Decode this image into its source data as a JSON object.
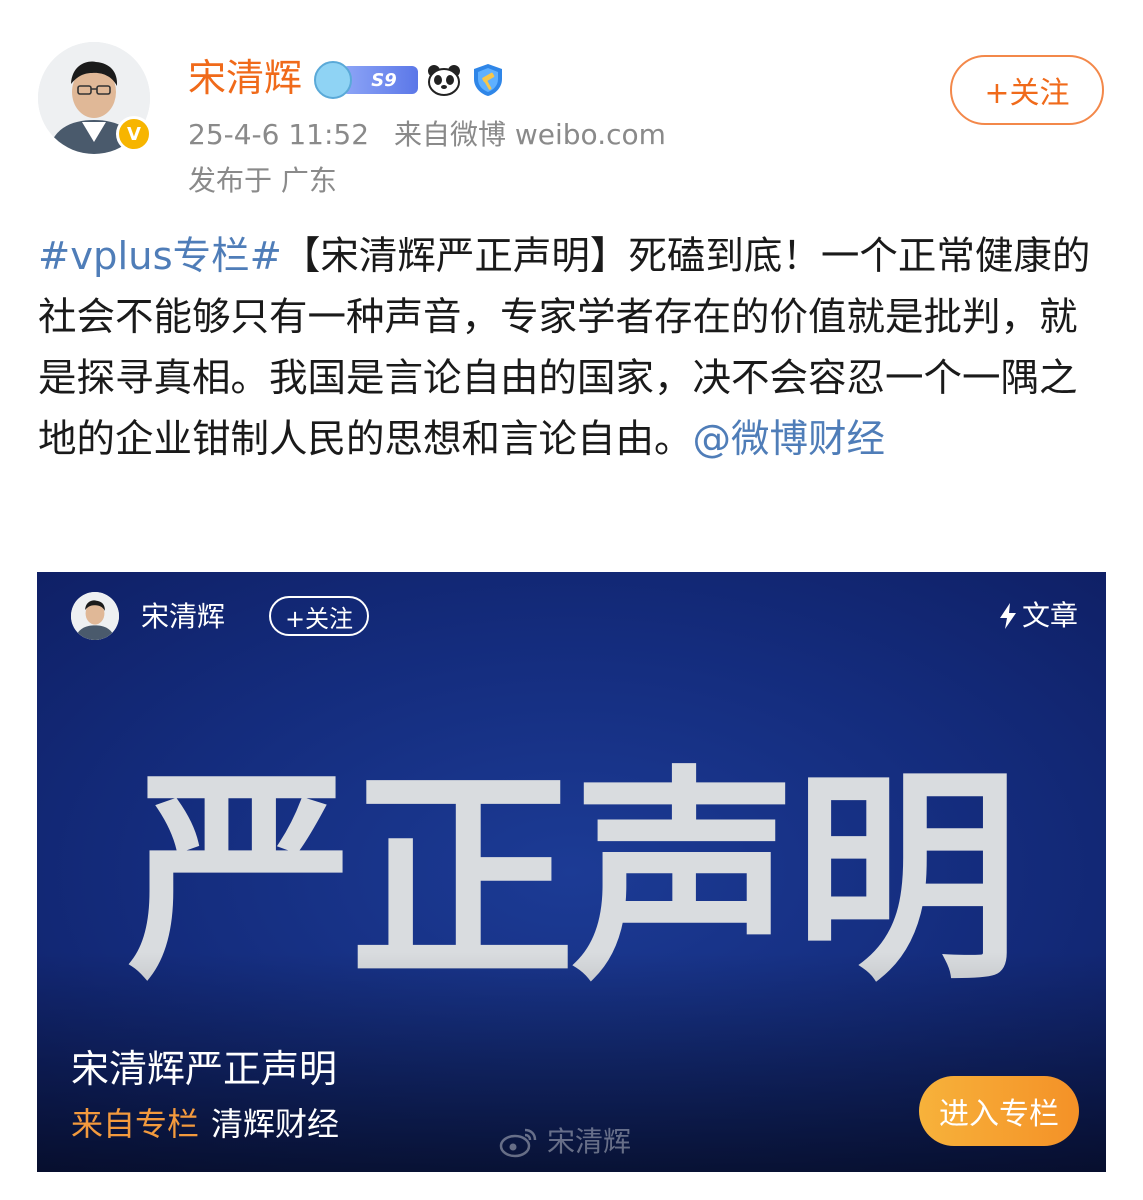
{
  "post": {
    "author": "宋清辉",
    "level_badge": "S9",
    "timestamp": "25-4-6 11:52",
    "source": "来自微博 weibo.com",
    "location": "发布于 广东",
    "follow_label": "+关注",
    "verified_badge": "V",
    "text": {
      "hashtag": "#vplus专栏#",
      "body": "【宋清辉严正声明】死磕到底！一个正常健康的社会不能够只有一种声音，专家学者存在的价值就是批判，就是探寻真相。我国是言论自由的国家，决不会容忍一个一隅之地的企业钳制人民的思想和言论自由。",
      "mention": "@微博财经"
    }
  },
  "card": {
    "author": "宋清辉",
    "follow_label": "+关注",
    "type_label": "文章",
    "headline": "严正声明",
    "title": "宋清辉严正声明",
    "source_label": "来自专栏",
    "source_name": "清辉财经",
    "cta_label": "进入专栏",
    "watermark": "宋清辉"
  },
  "colors": {
    "username": "#f06a1a",
    "link": "#4f7db8",
    "meta": "#8a8a8a",
    "card_bg": "#142c7d",
    "cta": "#f49127"
  }
}
